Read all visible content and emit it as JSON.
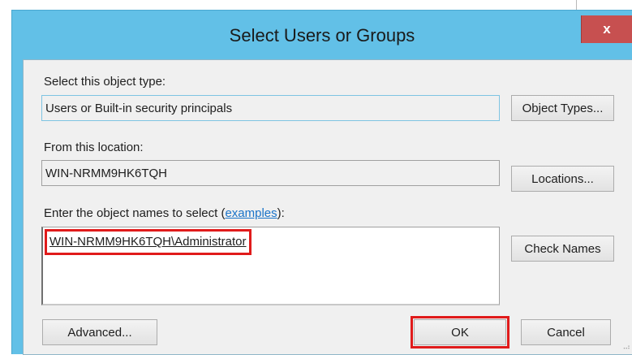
{
  "dialog": {
    "title": "Select Users or Groups",
    "close_label": "x"
  },
  "object_type": {
    "label": "Select this object type:",
    "value": "Users or Built-in security principals",
    "button": "Object Types..."
  },
  "location": {
    "label": "From this location:",
    "value": "WIN-NRMM9HK6TQH",
    "button": "Locations..."
  },
  "object_names": {
    "label_prefix": "Enter the object names to select (",
    "label_link": "examples",
    "label_suffix": "):",
    "value": "WIN-NRMM9HK6TQH\\Administrator",
    "check_button": "Check Names"
  },
  "footer": {
    "advanced": "Advanced...",
    "ok": "OK",
    "cancel": "Cancel"
  },
  "colors": {
    "title_bar": "#62c0e7",
    "close_button": "#c75050",
    "highlight": "#e01b1b",
    "link": "#1a73c8"
  }
}
